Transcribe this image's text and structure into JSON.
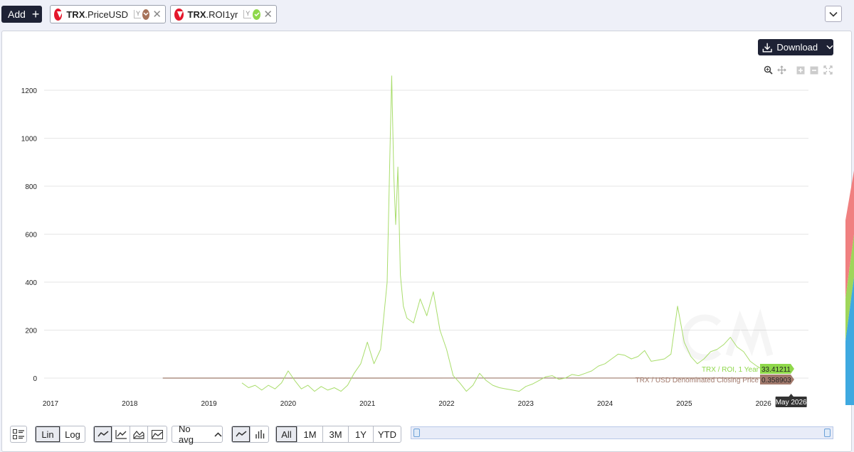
{
  "toolbar": {
    "add_label": "Add",
    "metrics": [
      {
        "asset": "TRX",
        "metric": ".PriceUSD",
        "axis_icon": "y-axis-icon",
        "color": "#a7735a",
        "state": "collapsed"
      },
      {
        "asset": "TRX",
        "metric": ".ROI1yr",
        "axis_icon": "y-axis-icon",
        "color": "#8fd84b",
        "state": "selected"
      }
    ]
  },
  "download_label": "Download",
  "controls": {
    "scale": [
      "Lin",
      "Log"
    ],
    "scale_selected": "Lin",
    "avg_label": "No avg",
    "ranges": [
      "All",
      "1M",
      "3M",
      "1Y",
      "YTD"
    ],
    "range_selected": "All"
  },
  "chart_data": {
    "type": "line",
    "x_ticks": [
      "2017",
      "2018",
      "2019",
      "2020",
      "2021",
      "2022",
      "2023",
      "2024",
      "2025",
      "2026"
    ],
    "y_ticks": [
      "0",
      "200",
      "400",
      "600",
      "800",
      "1000",
      "1200"
    ],
    "ylim": [
      -60,
      1290
    ],
    "grid": "horizontal",
    "crosshair_label": "May 2026",
    "colors": {
      "roi": "#a9dd6c",
      "price": "#9d7a6a",
      "roi_label_bg": "#8fd84b",
      "price_label_bg": "#a27a6d"
    },
    "series": [
      {
        "name": "TRX / ROI, 1 Year",
        "last_value_label": "33.41211",
        "points": [
          [
            "2019-06",
            -20
          ],
          [
            "2019-07",
            -40
          ],
          [
            "2019-08",
            -30
          ],
          [
            "2019-09",
            -50
          ],
          [
            "2019-10",
            -30
          ],
          [
            "2019-11",
            -45
          ],
          [
            "2019-12",
            -20
          ],
          [
            "2020-01",
            30
          ],
          [
            "2020-02",
            -10
          ],
          [
            "2020-03",
            -45
          ],
          [
            "2020-04",
            -30
          ],
          [
            "2020-05",
            -55
          ],
          [
            "2020-06",
            -35
          ],
          [
            "2020-07",
            -50
          ],
          [
            "2020-08",
            -40
          ],
          [
            "2020-09",
            -55
          ],
          [
            "2020-10",
            -30
          ],
          [
            "2020-11",
            20
          ],
          [
            "2020-12",
            60
          ],
          [
            "2021-01",
            150
          ],
          [
            "2021-02",
            60
          ],
          [
            "2021-03",
            120
          ],
          [
            "2021-04",
            400
          ],
          [
            "2021-04-15",
            990
          ],
          [
            "2021-04-22",
            1260
          ],
          [
            "2021-05-01",
            850
          ],
          [
            "2021-05-10",
            640
          ],
          [
            "2021-05-20",
            880
          ],
          [
            "2021-06-01",
            430
          ],
          [
            "2021-06-15",
            300
          ],
          [
            "2021-07",
            250
          ],
          [
            "2021-08",
            230
          ],
          [
            "2021-09",
            330
          ],
          [
            "2021-10",
            260
          ],
          [
            "2021-11",
            360
          ],
          [
            "2021-12",
            200
          ],
          [
            "2022-01",
            120
          ],
          [
            "2022-02",
            10
          ],
          [
            "2022-03",
            -20
          ],
          [
            "2022-04",
            -55
          ],
          [
            "2022-05",
            -30
          ],
          [
            "2022-06",
            20
          ],
          [
            "2022-07",
            -10
          ],
          [
            "2022-08",
            -30
          ],
          [
            "2022-09",
            -40
          ],
          [
            "2022-10",
            -45
          ],
          [
            "2022-11",
            -50
          ],
          [
            "2022-12",
            -55
          ],
          [
            "2023-01",
            -35
          ],
          [
            "2023-02",
            -25
          ],
          [
            "2023-03",
            -10
          ],
          [
            "2023-04",
            5
          ],
          [
            "2023-05",
            10
          ],
          [
            "2023-06",
            -5
          ],
          [
            "2023-07",
            0
          ],
          [
            "2023-08",
            15
          ],
          [
            "2023-09",
            10
          ],
          [
            "2023-10",
            20
          ],
          [
            "2023-11",
            30
          ],
          [
            "2023-12",
            50
          ],
          [
            "2024-01",
            60
          ],
          [
            "2024-02",
            80
          ],
          [
            "2024-03",
            100
          ],
          [
            "2024-04",
            95
          ],
          [
            "2024-05",
            80
          ],
          [
            "2024-06",
            90
          ],
          [
            "2024-07",
            115
          ],
          [
            "2024-08",
            70
          ],
          [
            "2024-09",
            75
          ],
          [
            "2024-10",
            80
          ],
          [
            "2024-11",
            100
          ],
          [
            "2024-12",
            300
          ],
          [
            "2025-01",
            150
          ],
          [
            "2025-02",
            90
          ],
          [
            "2025-03",
            60
          ],
          [
            "2025-04",
            80
          ],
          [
            "2025-05",
            110
          ],
          [
            "2025-06",
            120
          ],
          [
            "2025-07",
            140
          ],
          [
            "2025-08",
            170
          ],
          [
            "2025-09",
            130
          ],
          [
            "2025-10",
            110
          ],
          [
            "2025-11",
            70
          ],
          [
            "2025-12",
            50
          ],
          [
            "2026-01",
            33.41
          ]
        ]
      },
      {
        "name": "TRX / USD Denominated Closing Price",
        "last_value_label": "0.358903",
        "points": [
          [
            "2018-06",
            0.0
          ],
          [
            "2026-01",
            0.36
          ]
        ]
      }
    ]
  }
}
